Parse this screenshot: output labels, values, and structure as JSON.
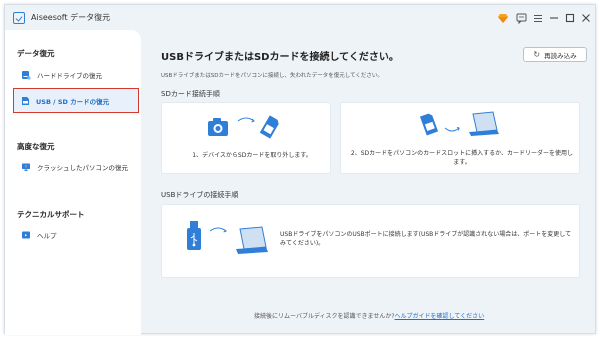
{
  "app": {
    "title": "Aiseesoft データ復元"
  },
  "sidebar": {
    "sections": [
      {
        "heading": "データ復元",
        "items": [
          {
            "label": "ハードドライブの復元"
          },
          {
            "label": "USB / SD カードの復元"
          }
        ]
      },
      {
        "heading": "高度な復元",
        "items": [
          {
            "label": "クラッシュしたパソコンの復元"
          }
        ]
      },
      {
        "heading": "テクニカルサポート",
        "items": [
          {
            "label": "ヘルプ"
          }
        ]
      }
    ]
  },
  "main": {
    "title": "USBドライブまたはSDカードを接続してください。",
    "refresh_label": "再読み込み",
    "subtitle": "USBドライブまたはSDカードをパソコンに接続し、失われたデータを復元してください。",
    "sd_section_title": "SDカード接続手順",
    "sd_steps": [
      {
        "text": "1、デバイスからSDカードを取り外します。"
      },
      {
        "text": "2、SDカードをパソコンのカードスロットに挿入するか、カードリーダーを使用します。"
      }
    ],
    "usb_section_title": "USBドライブの接続手順",
    "usb_step": {
      "text": "USBドライブをパソコンのUSBポートに接続します(USBドライブが認識されない場合は、ポートを変更してみてください)。"
    },
    "footer_text": "接続後にリムーバブルディスクを認識できませんか?",
    "footer_link": "ヘルプガイドを確認してください"
  },
  "colors": {
    "accent": "#1f6fc9",
    "highlight_border": "#d5392c",
    "background": "#eef3f8"
  },
  "icons": [
    "app-logo-icon",
    "premium-icon",
    "feedback-icon",
    "menu-icon",
    "minimize-icon",
    "maximize-icon",
    "close-icon",
    "hard-drive-icon",
    "sd-card-icon",
    "crashed-pc-icon",
    "help-icon",
    "refresh-icon"
  ]
}
